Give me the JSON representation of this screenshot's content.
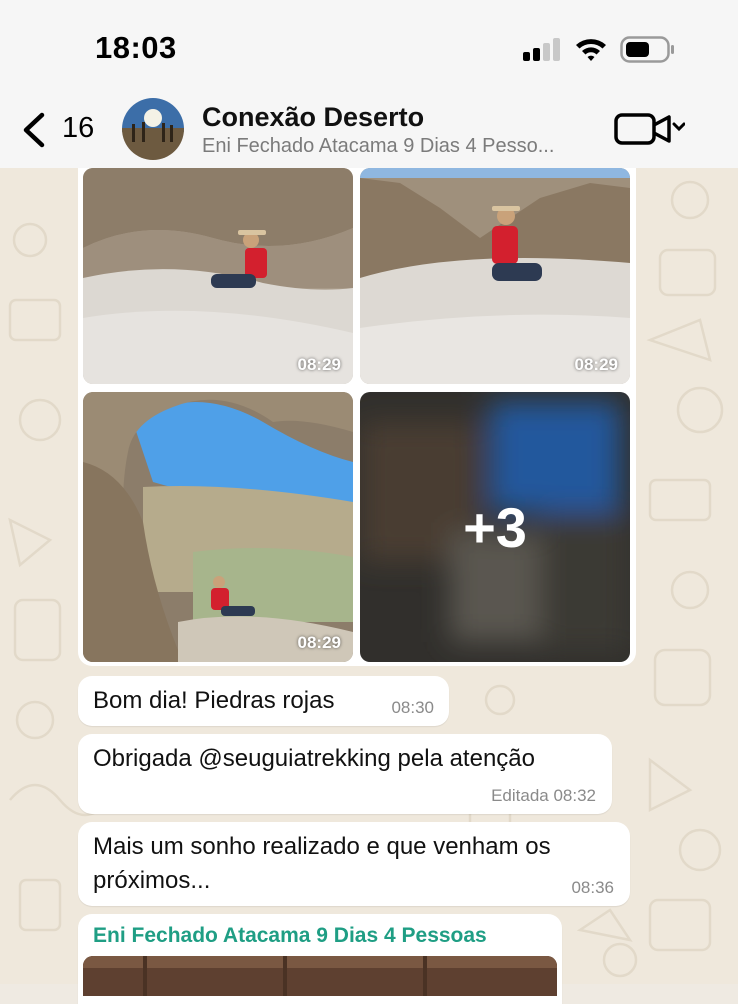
{
  "status_bar": {
    "time": "18:03"
  },
  "header": {
    "back_count": "16",
    "group_name": "Conexão Deserto",
    "group_subtitle": "Eni Fechado Atacama 9 Dias 4 Pesso..."
  },
  "album": {
    "tiles": [
      {
        "time": "08:29"
      },
      {
        "time": "08:29"
      },
      {
        "time": "08:29"
      }
    ],
    "more_count": "+3"
  },
  "messages": [
    {
      "text": "Bom dia! Piedras rojas",
      "time": "08:30"
    },
    {
      "text": "Obrigada @seuguiatrekking pela atenção",
      "time": "Editada 08:32"
    },
    {
      "text_line1": "Mais um sonho realizado e que venham os",
      "text_line2": "próximos...",
      "time": "08:36"
    },
    {
      "sender": "Eni Fechado Atacama 9 Dias 4 Pessoas"
    }
  ],
  "colors": {
    "sender_name": "#1f9e84",
    "wallpaper": "#efe8dc",
    "bubble": "#ffffff"
  }
}
